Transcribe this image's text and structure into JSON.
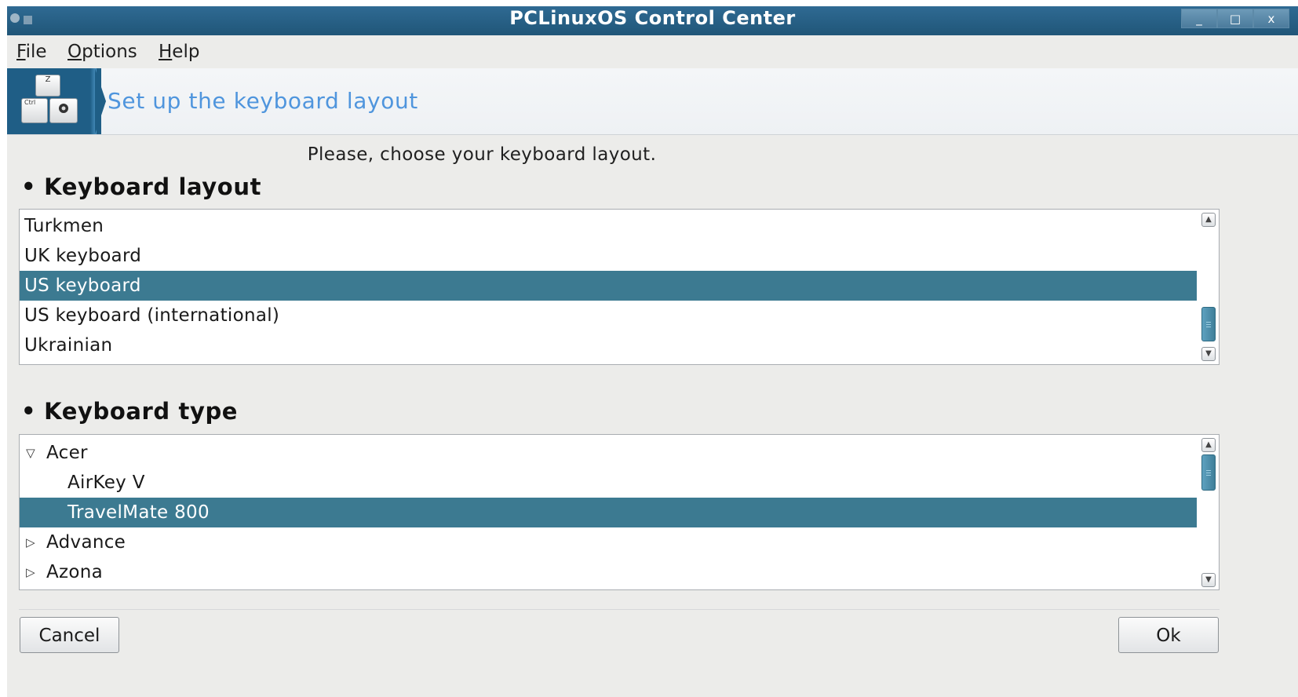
{
  "window": {
    "title": "PCLinuxOS Control Center",
    "controls": {
      "minimize": "_",
      "maximize": "□",
      "close": "x"
    }
  },
  "menubar": {
    "file": {
      "mnemonic": "F",
      "rest": "ile"
    },
    "options": {
      "mnemonic": "O",
      "rest": "ptions"
    },
    "help": {
      "mnemonic": "H",
      "rest": "elp"
    }
  },
  "banner": {
    "title": "Set up the keyboard layout",
    "icon": "keyboard-keys-icon",
    "key_labels": [
      "Z",
      "Ctrl"
    ]
  },
  "instruction": "Please, choose your keyboard layout.",
  "layout_section": {
    "bullet": "•",
    "title": "Keyboard layout",
    "items": [
      {
        "label": "Turkmen",
        "selected": false
      },
      {
        "label": "UK keyboard",
        "selected": false
      },
      {
        "label": "US keyboard",
        "selected": true
      },
      {
        "label": "US keyboard (international)",
        "selected": false
      },
      {
        "label": "Ukrainian",
        "selected": false
      }
    ]
  },
  "type_section": {
    "bullet": "•",
    "title": "Keyboard type",
    "items": [
      {
        "label": "Acer",
        "level": 0,
        "expander": "expanded",
        "selected": false
      },
      {
        "label": "AirKey V",
        "level": 1,
        "expander": "none",
        "selected": false
      },
      {
        "label": "TravelMate 800",
        "level": 1,
        "expander": "none",
        "selected": true
      },
      {
        "label": "Advance",
        "level": 0,
        "expander": "collapsed",
        "selected": false
      },
      {
        "label": "Azona",
        "level": 0,
        "expander": "collapsed",
        "selected": false
      }
    ]
  },
  "buttons": {
    "cancel": "Cancel",
    "ok": "Ok"
  },
  "colors": {
    "titlebar": "#205678",
    "selection": "#3c7a91",
    "banner_title": "#4f95dd"
  }
}
